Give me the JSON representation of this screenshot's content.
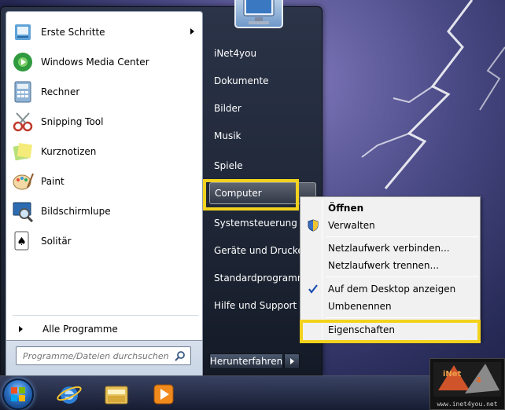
{
  "colors": {
    "highlight": "#f3d21e",
    "menu_dark": "#1e2636",
    "menu_text": "#ffffff"
  },
  "left_pane": {
    "programs": [
      {
        "label": "Erste Schritte",
        "icon": "getting-started-icon",
        "has_submenu": true
      },
      {
        "label": "Windows Media Center",
        "icon": "media-center-icon",
        "has_submenu": false
      },
      {
        "label": "Rechner",
        "icon": "calculator-icon",
        "has_submenu": false
      },
      {
        "label": "Snipping Tool",
        "icon": "scissors-icon",
        "has_submenu": false
      },
      {
        "label": "Kurznotizen",
        "icon": "sticky-notes-icon",
        "has_submenu": false
      },
      {
        "label": "Paint",
        "icon": "paint-icon",
        "has_submenu": false
      },
      {
        "label": "Bildschirmlupe",
        "icon": "magnifier-icon",
        "has_submenu": false
      },
      {
        "label": "Solitär",
        "icon": "solitaire-icon",
        "has_submenu": false
      }
    ],
    "all_programs": "Alle Programme",
    "search_placeholder": "Programme/Dateien durchsuchen"
  },
  "right_pane": {
    "items": [
      {
        "label": "iNet4you"
      },
      {
        "label": "Dokumente"
      },
      {
        "label": "Bilder"
      },
      {
        "label": "Musik"
      },
      {
        "label": "Spiele"
      },
      {
        "label": "Computer"
      },
      {
        "label": "Systemsteuerung"
      },
      {
        "label": "Geräte und Drucker"
      },
      {
        "label": "Standardprogramme"
      },
      {
        "label": "Hilfe und Support"
      }
    ],
    "shutdown": "Herunterfahren"
  },
  "context_menu": {
    "items": [
      {
        "label": "Öffnen"
      },
      {
        "label": "Verwalten"
      },
      {
        "label": "Netzlaufwerk verbinden..."
      },
      {
        "label": "Netzlaufwerk trennen..."
      },
      {
        "label": "Auf dem Desktop anzeigen"
      },
      {
        "label": "Umbenennen"
      },
      {
        "label": "Eigenschaften"
      }
    ]
  },
  "taskbar": {
    "buttons": [
      "start-orb-icon",
      "internet-explorer-icon",
      "windows-explorer-icon",
      "media-player-icon"
    ]
  },
  "watermark": {
    "text": "www.inet4you.net"
  }
}
